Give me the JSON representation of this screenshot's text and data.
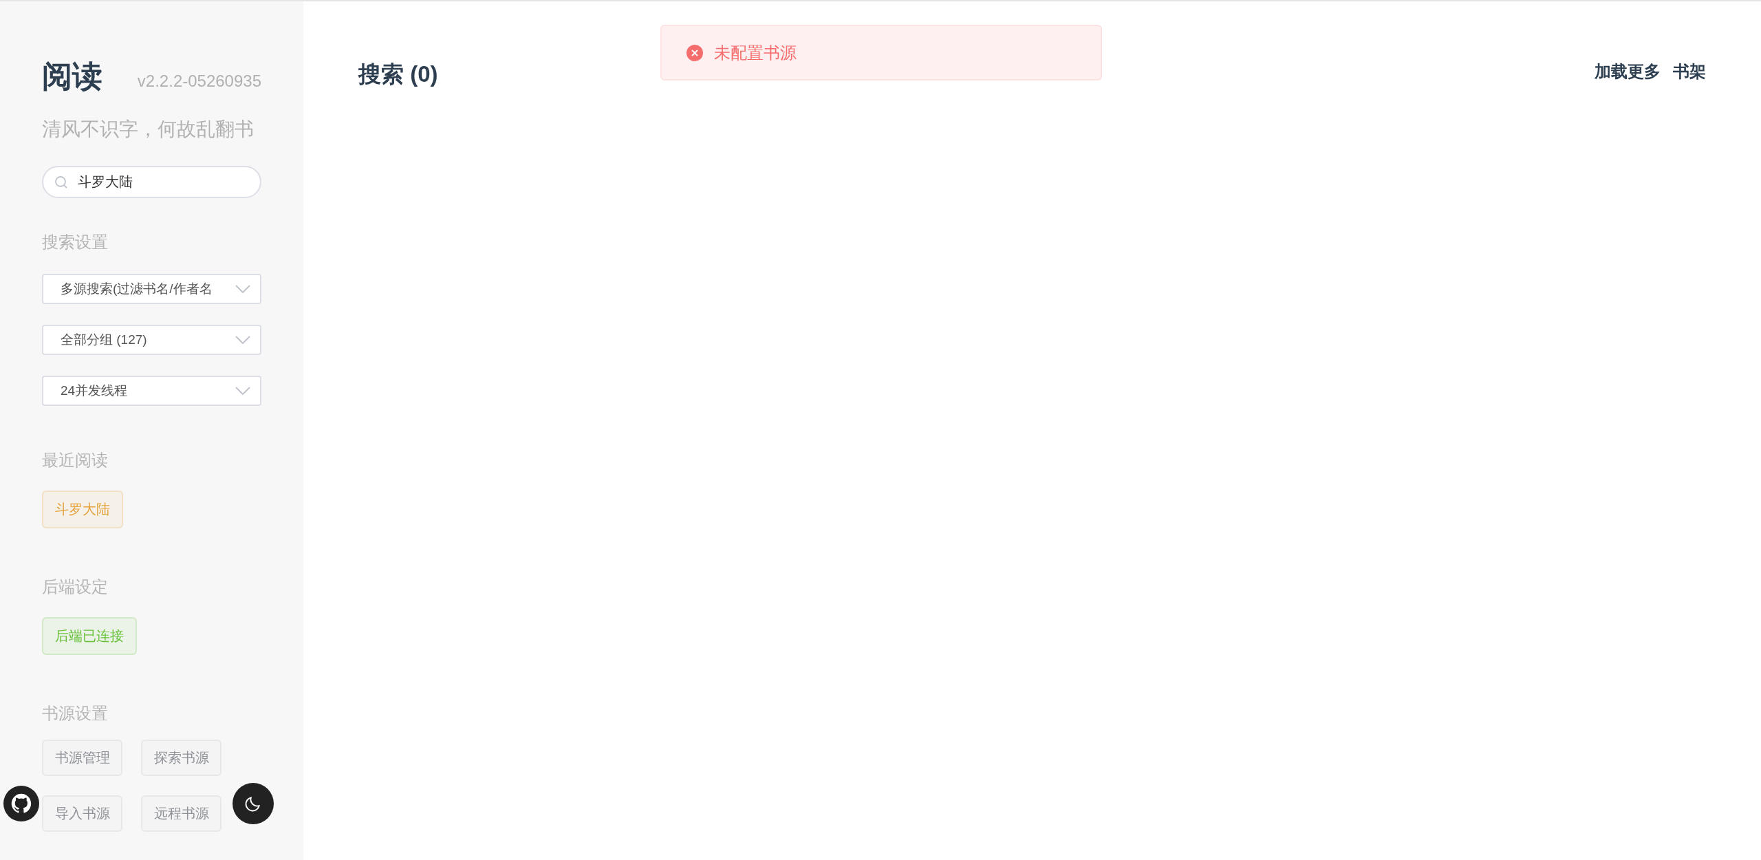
{
  "sidebar": {
    "title": "阅读",
    "version": "v2.2.2-05260935",
    "motto": "清风不识字，何故乱翻书",
    "search": {
      "value": "斗罗大陆"
    },
    "sections": [
      {
        "kind": "selects",
        "heading": "搜索设置",
        "items": [
          {
            "label": "多源搜索(过滤书名/作者名"
          },
          {
            "label": "全部分组 (127)"
          },
          {
            "label": "24并发线程"
          }
        ]
      },
      {
        "kind": "tags",
        "heading": "最近阅读",
        "items": [
          {
            "label": "斗罗大陆",
            "color": "#e6a23c"
          }
        ]
      },
      {
        "kind": "tags",
        "heading": "后端设定",
        "items": [
          {
            "label": "后端已连接",
            "color": "#67c23a"
          }
        ]
      },
      {
        "kind": "buttons",
        "heading": "书源设置",
        "items": [
          {
            "label": "书源管理"
          },
          {
            "label": "探索书源"
          },
          {
            "label": "导入书源"
          },
          {
            "label": "远程书源"
          }
        ]
      }
    ]
  },
  "main": {
    "title": "搜索 (0)",
    "actions": [
      "加载更多",
      "书架"
    ]
  },
  "message": {
    "kind": "error",
    "text": "未配置书源"
  }
}
